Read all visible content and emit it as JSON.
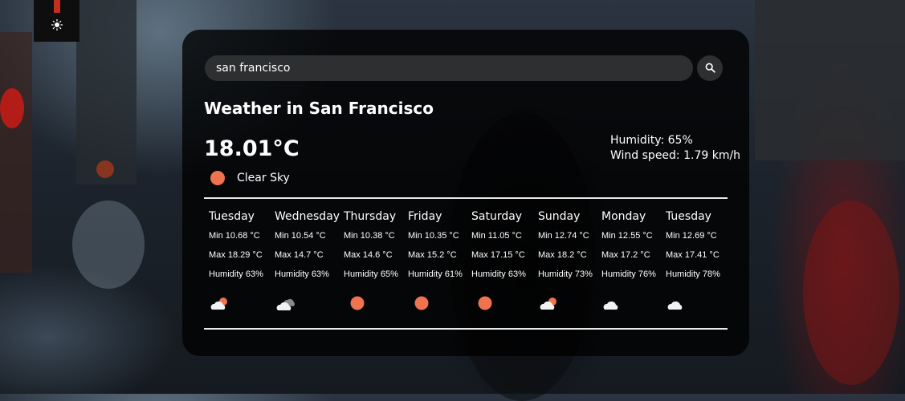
{
  "theme_toggle": {
    "icon": "sun-icon",
    "indicator_color": "#c0301d"
  },
  "search": {
    "value": "san francisco",
    "button_icon": "search-icon"
  },
  "weather": {
    "title": "Weather in San Francisco",
    "temperature": "18.01°C",
    "condition": "Clear Sky",
    "condition_icon": "sun-icon",
    "humidity": "Humidity: 65%",
    "wind": "Wind speed: 1.79 km/h"
  },
  "forecast": [
    {
      "day": "Tuesday",
      "min": "Min 10.68 °C",
      "max": "Max 18.29 °C",
      "humidity": "Humidity 63%",
      "icon": "partly-cloudy-icon"
    },
    {
      "day": "Wednesday",
      "min": "Min 10.54 °C",
      "max": "Max 14.7 °C",
      "humidity": "Humidity 63%",
      "icon": "overcast-cloud-icon"
    },
    {
      "day": "Thursday",
      "min": "Min 10.38 °C",
      "max": "Max 14.6 °C",
      "humidity": "Humidity 65%",
      "icon": "sun-icon"
    },
    {
      "day": "Friday",
      "min": "Min 10.35 °C",
      "max": "Max 15.2 °C",
      "humidity": "Humidity 61%",
      "icon": "sun-icon"
    },
    {
      "day": "Saturday",
      "min": "Min 11.05 °C",
      "max": "Max 17.15 °C",
      "humidity": "Humidity 63%",
      "icon": "sun-icon"
    },
    {
      "day": "Sunday",
      "min": "Min 12.74 °C",
      "max": "Max 18.2 °C",
      "humidity": "Humidity 73%",
      "icon": "partly-cloudy-icon"
    },
    {
      "day": "Monday",
      "min": "Min 12.55 °C",
      "max": "Max 17.2 °C",
      "humidity": "Humidity 76%",
      "icon": "cloud-icon"
    },
    {
      "day": "Tuesday",
      "min": "Min 12.69 °C",
      "max": "Max 17.41 °C",
      "humidity": "Humidity 78%",
      "icon": "cloud-icon"
    }
  ],
  "colors": {
    "sun": "#f07350",
    "cloud": "#f2f2f2",
    "card_bg": "#000000"
  }
}
